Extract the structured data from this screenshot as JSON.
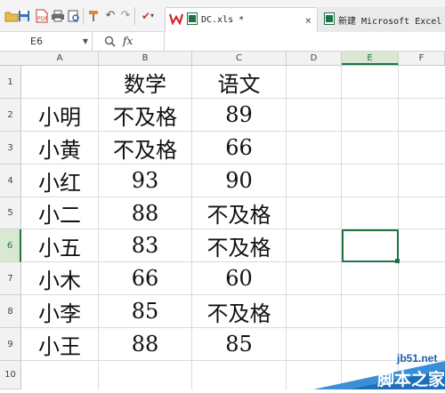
{
  "toolbar": {
    "icons": [
      "folder-icon",
      "save-icon",
      "pdf-icon",
      "print-icon",
      "print-preview-icon",
      "format-painter-icon",
      "undo-icon",
      "redo-icon",
      "redo-dropdown-icon",
      "pin-icon",
      "wps-logo-icon"
    ],
    "tabs": [
      {
        "label": "DC.xls *",
        "close": "×",
        "active": true
      },
      {
        "label": "新建 Microsoft Excel 工",
        "active": false
      }
    ]
  },
  "formula_bar": {
    "name_box": "E6",
    "fx_label": "fx",
    "formula": ""
  },
  "columns": [
    "A",
    "B",
    "C",
    "D",
    "E",
    "F"
  ],
  "rows": [
    "1",
    "2",
    "3",
    "4",
    "5",
    "6",
    "7",
    "8",
    "9",
    "10"
  ],
  "selected": {
    "column": "E",
    "row": "6"
  },
  "cells": [
    [
      "",
      "数学",
      "语文"
    ],
    [
      "小明",
      "不及格",
      "89"
    ],
    [
      "小黄",
      "不及格",
      "66"
    ],
    [
      "小红",
      "93",
      "90"
    ],
    [
      "小二",
      "88",
      "不及格"
    ],
    [
      "小五",
      "83",
      "不及格"
    ],
    [
      "小木",
      "66",
      "60"
    ],
    [
      "小李",
      "85",
      "不及格"
    ],
    [
      "小王",
      "88",
      "85"
    ],
    [
      "",
      "",
      ""
    ]
  ],
  "watermark": {
    "line1": "jb51.net",
    "line2": "脚本之家"
  },
  "colors": {
    "accent": "#217346",
    "selection_bg": "#d9e8d3",
    "wps_red": "#d6262b"
  }
}
